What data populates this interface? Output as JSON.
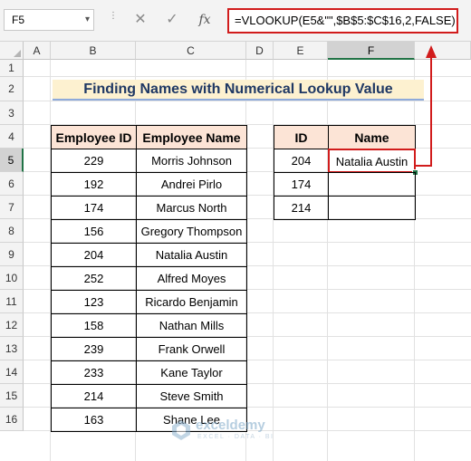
{
  "formula_bar": {
    "name_box": "F5",
    "cancel_symbol": "✕",
    "enter_symbol": "✓",
    "fx_label": "fx",
    "formula": "=VLOOKUP(E5&\"\",$B$5:$C$16,2,FALSE)"
  },
  "columns": [
    "A",
    "B",
    "C",
    "D",
    "E",
    "F"
  ],
  "rows": [
    "1",
    "2",
    "3",
    "4",
    "5",
    "6",
    "7",
    "8",
    "9",
    "10",
    "11",
    "12",
    "13",
    "14",
    "15",
    "16"
  ],
  "selected_cell": {
    "column": "F",
    "row": "5"
  },
  "title": "Finding Names with Numerical Lookup Value",
  "employee_table": {
    "headers": [
      "Employee ID",
      "Employee Name"
    ],
    "rows": [
      [
        "229",
        "Morris Johnson"
      ],
      [
        "192",
        "Andrei Pirlo"
      ],
      [
        "174",
        "Marcus North"
      ],
      [
        "156",
        "Gregory Thompson"
      ],
      [
        "204",
        "Natalia Austin"
      ],
      [
        "252",
        "Alfred Moyes"
      ],
      [
        "123",
        "Ricardo Benjamin"
      ],
      [
        "158",
        "Nathan Mills"
      ],
      [
        "239",
        "Frank Orwell"
      ],
      [
        "233",
        "Kane Taylor"
      ],
      [
        "214",
        "Steve Smith"
      ],
      [
        "163",
        "Shane Lee"
      ]
    ]
  },
  "lookup_table": {
    "headers": [
      "ID",
      "Name"
    ],
    "rows": [
      [
        "204",
        "Natalia Austin"
      ],
      [
        "174",
        ""
      ],
      [
        "214",
        ""
      ]
    ]
  },
  "watermark": {
    "brand": "exceldemy",
    "tagline": "EXCEL · DATA · BI"
  },
  "colors": {
    "accent_red": "#d11c1c",
    "header_fill": "#fce4d6",
    "title_fill": "#fdf1d0",
    "title_text": "#1f3864",
    "excel_green": "#217346"
  }
}
